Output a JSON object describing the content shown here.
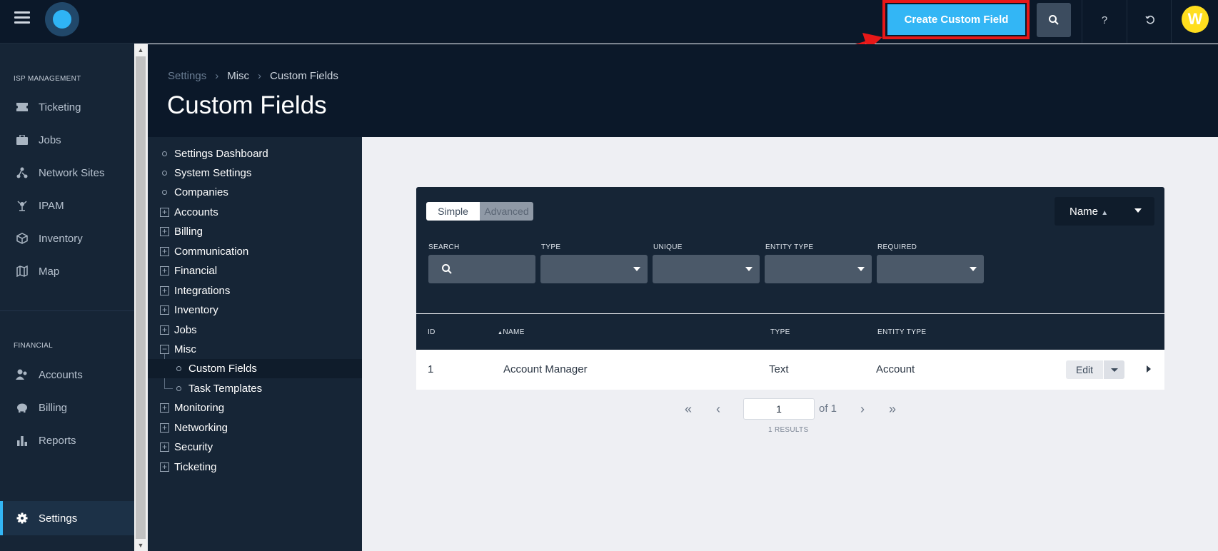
{
  "topbar": {
    "create_button_label": "Create Custom Field",
    "help_label": "?",
    "avatar_initial": "W",
    "accent_color": "#33b6f5",
    "highlight_color": "#e81818"
  },
  "leftnav": {
    "section_isp": "ISP MANAGEMENT",
    "section_financial": "FINANCIAL",
    "items": [
      {
        "label": "Ticketing",
        "icon": "ticket-icon"
      },
      {
        "label": "Jobs",
        "icon": "briefcase-icon"
      },
      {
        "label": "Network Sites",
        "icon": "network-icon"
      },
      {
        "label": "IPAM",
        "icon": "ipam-icon"
      },
      {
        "label": "Inventory",
        "icon": "box-icon"
      },
      {
        "label": "Map",
        "icon": "map-icon"
      },
      {
        "label": "Accounts",
        "icon": "users-icon"
      },
      {
        "label": "Billing",
        "icon": "piggy-bank-icon"
      },
      {
        "label": "Reports",
        "icon": "bar-chart-icon"
      },
      {
        "label": "Settings",
        "icon": "gear-icon"
      }
    ]
  },
  "header": {
    "breadcrumb": [
      "Settings",
      "Misc",
      "Custom Fields"
    ],
    "title": "Custom Fields"
  },
  "subnav": {
    "items": [
      "Settings Dashboard",
      "System Settings",
      "Companies",
      "Accounts",
      "Billing",
      "Communication",
      "Financial",
      "Integrations",
      "Inventory",
      "Jobs",
      "Misc",
      "Custom Fields",
      "Task Templates",
      "Monitoring",
      "Networking",
      "Security",
      "Ticketing"
    ]
  },
  "filters": {
    "mode_simple": "Simple",
    "mode_advanced": "Advanced",
    "sort_label": "Name",
    "labels": [
      "SEARCH",
      "TYPE",
      "UNIQUE",
      "ENTITY TYPE",
      "REQUIRED"
    ]
  },
  "table": {
    "columns": [
      "ID",
      "NAME",
      "TYPE",
      "ENTITY TYPE"
    ],
    "rows": [
      {
        "id": "1",
        "name": "Account Manager",
        "type": "Text",
        "entity_type": "Account"
      }
    ],
    "edit_label": "Edit"
  },
  "pagination": {
    "current_page": "1",
    "of_label": "of 1",
    "results_label": "1 RESULTS"
  }
}
